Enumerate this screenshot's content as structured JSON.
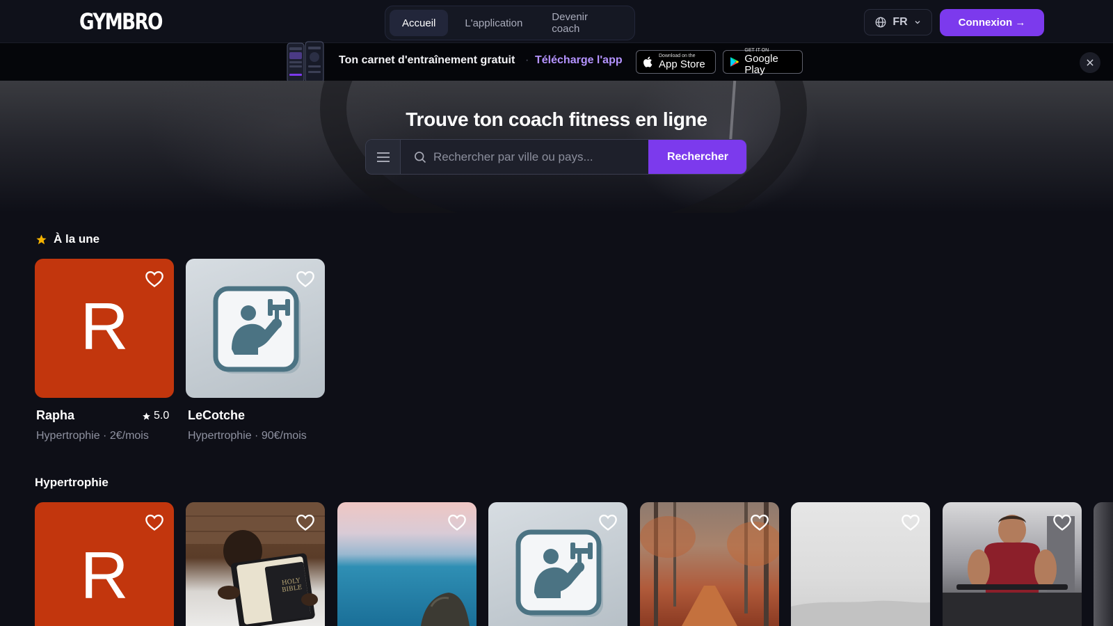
{
  "brand": {
    "logo_text": "GYMBRO"
  },
  "nav": {
    "tabs": [
      {
        "label": "Accueil",
        "active": true
      },
      {
        "label": "L'application",
        "active": false
      },
      {
        "label": "Devenir coach",
        "active": false
      }
    ],
    "language": "FR",
    "login_label": "Connexion →"
  },
  "banner": {
    "text": "Ton carnet d'entraînement gratuit",
    "separator": "·",
    "link": "Télécharge l'app",
    "app_store": {
      "small": "Download on the",
      "big": "App Store"
    },
    "google_play": {
      "small": "GET IT ON",
      "big": "Google Play"
    }
  },
  "hero": {
    "title": "Trouve ton coach fitness en ligne",
    "search_placeholder": "Rechercher par ville ou pays...",
    "search_button": "Rechercher"
  },
  "featured": {
    "title": "À la une",
    "items": [
      {
        "name": "Rapha",
        "rating": "5.0",
        "meta": "Hypertrophie · 2€/mois",
        "letter": "R"
      },
      {
        "name": "LeCotche",
        "rating": "",
        "meta": "Hypertrophie · 90€/mois"
      }
    ]
  },
  "hypertrophie": {
    "title": "Hypertrophie",
    "book_text": "HOLY BIBLE"
  },
  "colors": {
    "accent": "#7c3aed",
    "background": "#0e0f17",
    "card_orange": "#c2360d",
    "link": "#b493ff"
  }
}
